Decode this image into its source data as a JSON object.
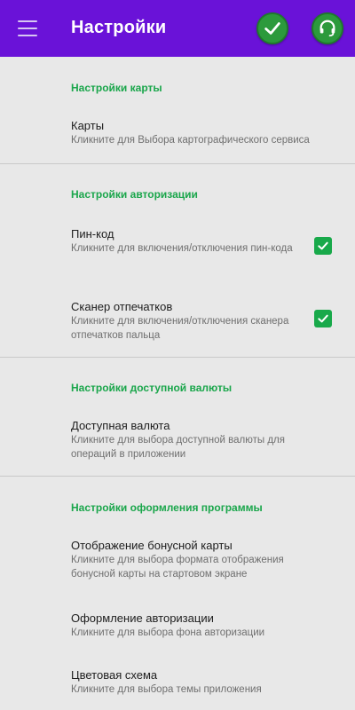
{
  "appbar": {
    "title": "Настройки",
    "menu_icon": "hamburger-menu-icon",
    "confirm_icon": "checkmark-icon",
    "support_icon": "headset-support-icon",
    "color": "#6a12d8",
    "button_color": "#2c9a3c"
  },
  "sections": [
    {
      "header": "Настройки карты",
      "items": [
        {
          "title": "Карты",
          "subtitle": "Кликните для Выбора картографического сервиса"
        }
      ]
    },
    {
      "header": "Настройки авторизации",
      "items": [
        {
          "title": "Пин-код",
          "subtitle": "Кликните для включения/отключения пин-кода",
          "checked": true
        },
        {
          "title": "Сканер отпечатков",
          "subtitle": "Кликните для включения/отключения сканера отпечатков пальца",
          "checked": true
        }
      ]
    },
    {
      "header": "Настройки доступной валюты",
      "items": [
        {
          "title": "Доступная валюта",
          "subtitle": "Кликните для выбора доступной валюты для операций в приложении"
        }
      ]
    },
    {
      "header": "Настройки оформления программы",
      "items": [
        {
          "title": "Отображение бонусной карты",
          "subtitle": "Кликните для выбора формата отображения бонусной карты на стартовом экране"
        },
        {
          "title": "Оформление авторизации",
          "subtitle": "Кликните для выбора фона авторизации"
        },
        {
          "title": "Цветовая схема",
          "subtitle": "Кликните для выбора темы приложения"
        }
      ]
    }
  ],
  "accent_color": "#1aa64b"
}
